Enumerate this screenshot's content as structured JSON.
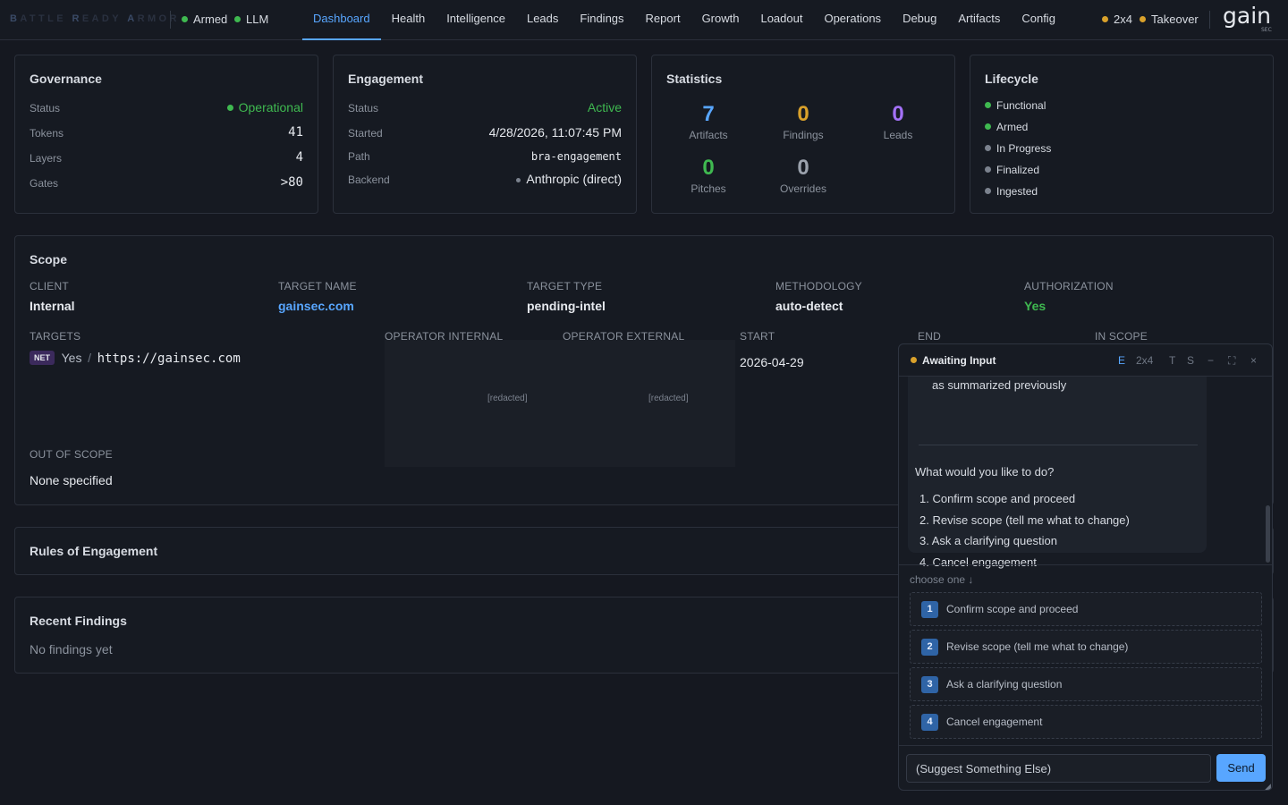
{
  "header": {
    "brand": [
      "B",
      "ATTLE ",
      "R",
      "EADY ",
      "A",
      "RMOR"
    ],
    "armed": "Armed",
    "llm": "LLM",
    "tabs": [
      "Dashboard",
      "Health",
      "Intelligence",
      "Leads",
      "Findings",
      "Report",
      "Growth",
      "Loadout",
      "Operations",
      "Debug",
      "Artifacts",
      "Config"
    ],
    "active_tab": "Dashboard",
    "mode": "2x4",
    "takeover": "Takeover",
    "logo_text": "gain",
    "logo_sub": "SEC",
    "colors": {
      "accent": "#58a6ff",
      "ok": "#3fb950",
      "warn": "#d9a12b"
    }
  },
  "governance": {
    "title": "Governance",
    "rows": [
      {
        "k": "Status",
        "v": "Operational"
      },
      {
        "k": "Tokens",
        "v": "41"
      },
      {
        "k": "Layers",
        "v": "4"
      },
      {
        "k": "Gates",
        "v": ">80"
      }
    ]
  },
  "engagement": {
    "title": "Engagement",
    "rows": [
      {
        "k": "Status",
        "v": "Active"
      },
      {
        "k": "Started",
        "v": "4/28/2026, 11:07:45 PM"
      },
      {
        "k": "Path",
        "v": "bra-engagement"
      },
      {
        "k": "Backend",
        "v": "Anthropic (direct)"
      }
    ]
  },
  "statistics": {
    "title": "Statistics",
    "items": [
      {
        "num": "7",
        "label": "Artifacts",
        "color": "#58a6ff"
      },
      {
        "num": "0",
        "label": "Findings",
        "color": "#d9a12b"
      },
      {
        "num": "0",
        "label": "Leads",
        "color": "#a371f7"
      },
      {
        "num": "0",
        "label": "Pitches",
        "color": "#3fb950"
      },
      {
        "num": "0",
        "label": "Overrides",
        "color": "#9aa1ac"
      }
    ]
  },
  "lifecycle": {
    "title": "Lifecycle",
    "items": [
      {
        "label": "Functional",
        "state": "done"
      },
      {
        "label": "Armed",
        "state": "done"
      },
      {
        "label": "In Progress",
        "state": "pending"
      },
      {
        "label": "Finalized",
        "state": "pending"
      },
      {
        "label": "Ingested",
        "state": "pending"
      }
    ]
  },
  "scope": {
    "title": "Scope",
    "client_label": "CLIENT",
    "client": "Internal",
    "target_name_label": "TARGET NAME",
    "target_name": "gainsec.com",
    "target_type_label": "TARGET TYPE",
    "target_type": "pending-intel",
    "methodology_label": "METHODOLOGY",
    "methodology": "auto-detect",
    "authorization_label": "AUTHORIZATION",
    "authorization": "Yes",
    "targets_label": "TARGETS",
    "target_badge": "NET",
    "target_yes": "Yes",
    "target_slash": "/",
    "target_url": "https://gainsec.com",
    "operator_internal_label": "OPERATOR INTERNAL",
    "operator_internal": "[redacted]",
    "operator_external_label": "OPERATOR EXTERNAL",
    "operator_external": "[redacted]",
    "start_label": "START",
    "start": "2026-04-29",
    "end_label": "END",
    "in_scope_label": "IN SCOPE",
    "out_of_scope_label": "OUT OF SCOPE",
    "out_of_scope": "None specified"
  },
  "rules": {
    "title": "Rules of Engagement"
  },
  "recent_findings": {
    "title": "Recent Findings",
    "empty": "No findings yet"
  },
  "chat": {
    "title": "Awaiting Input",
    "controls": [
      "E",
      "2x4",
      "T",
      "S",
      "−",
      "⛶",
      "×"
    ],
    "message_top": "as summarized previously",
    "question": "What would you like to do?",
    "list": [
      "1. Confirm scope and proceed",
      "2. Revise scope (tell me what to change)",
      "3. Ask a clarifying question",
      "4. Cancel engagement"
    ],
    "choose_hint": "choose one ↓",
    "options": [
      {
        "n": "1",
        "text": "Confirm scope and proceed"
      },
      {
        "n": "2",
        "text": "Revise scope (tell me what to change)"
      },
      {
        "n": "3",
        "text": "Ask a clarifying question"
      },
      {
        "n": "4",
        "text": "Cancel engagement"
      }
    ],
    "input_value": "(Suggest Something Else)",
    "send_label": "Send"
  }
}
